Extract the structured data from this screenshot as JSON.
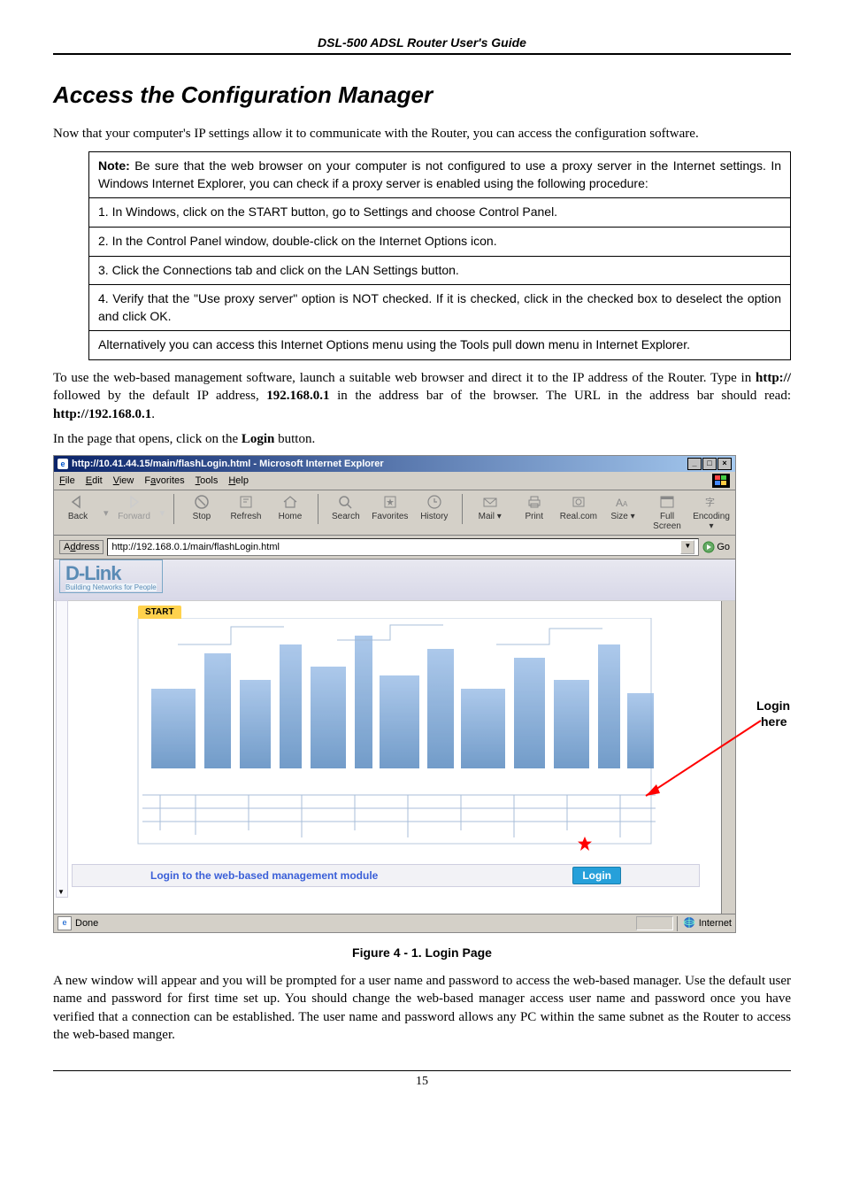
{
  "doc": {
    "header": "DSL-500 ADSL Router User's Guide",
    "section_title": "Access the Configuration  Manager",
    "intro": "Now that your computer's IP settings allow it to communicate with the Router, you can access the configuration software.",
    "note": {
      "label": "Note:",
      "lead": " Be sure that the web browser on your computer is not configured to use a proxy server in the Internet settings. In Windows Internet Explorer, you can check if a proxy server is enabled using the following procedure:",
      "s1": "1. In Windows, click on the START button, go to Settings and choose Control Panel.",
      "s2": "2. In the Control Panel window, double-click on the Internet Options icon.",
      "s3": "3. Click the Connections tab and click on the LAN Settings button.",
      "s4": "4. Verify that the \"Use proxy server\" option is NOT checked. If it is checked, click in the checked box to deselect the option and click OK.",
      "s5": "Alternatively you can access this Internet Options menu using the Tools pull down menu in Internet Explorer."
    },
    "after_note_a": "To use the web-based management software, launch a suitable web browser and direct it to the IP address of the Router. Type in ",
    "after_note_b": "http://",
    "after_note_c": " followed by the default IP address, ",
    "after_note_d": "192.168.0.1",
    "after_note_e": " in the address bar of the browser. The URL in the address bar should read: ",
    "after_note_f": "http://192.168.0.1",
    "after_note_g": ".",
    "click_login_a": "In the page that opens, click on the ",
    "click_login_b": "Login",
    "click_login_c": " button.",
    "figure_caption": "Figure 4 -  1. Login Page",
    "outro": "A new window will appear and you will be prompted for a user name and password to access the web-based manager. Use the default user name               and password              for first time set up. You should change the web-based manager access user name and password once you have verified that a connection can be established. The user name and password allows any PC within the same subnet as the Router to access the web-based manger.",
    "side_label_1": "Login",
    "side_label_2": "here",
    "page_number": "15"
  },
  "ie": {
    "title": "http://10.41.44.15/main/flashLogin.html - Microsoft Internet Explorer",
    "menu": {
      "file": "File",
      "edit": "Edit",
      "view": "View",
      "favorites": "Favorites",
      "tools": "Tools",
      "help": "Help"
    },
    "toolbar": {
      "back": "Back",
      "forward": "Forward",
      "stop": "Stop",
      "refresh": "Refresh",
      "home": "Home",
      "search": "Search",
      "favorites": "Favorites",
      "history": "History",
      "mail": "Mail",
      "print": "Print",
      "realcom": "Real.com",
      "size": "Size",
      "fullscreen": "Full Screen",
      "encoding": "Encoding"
    },
    "addr_label": "Address",
    "addr_value": "http://192.168.0.1/main/flashLogin.html",
    "go": "Go",
    "status_done": "Done",
    "status_zone": "Internet",
    "dlink_brand": "D-Link",
    "dlink_tag": "Building Networks for People",
    "start": "START",
    "login_text": "Login to the web-based management module",
    "login_btn": "Login"
  }
}
